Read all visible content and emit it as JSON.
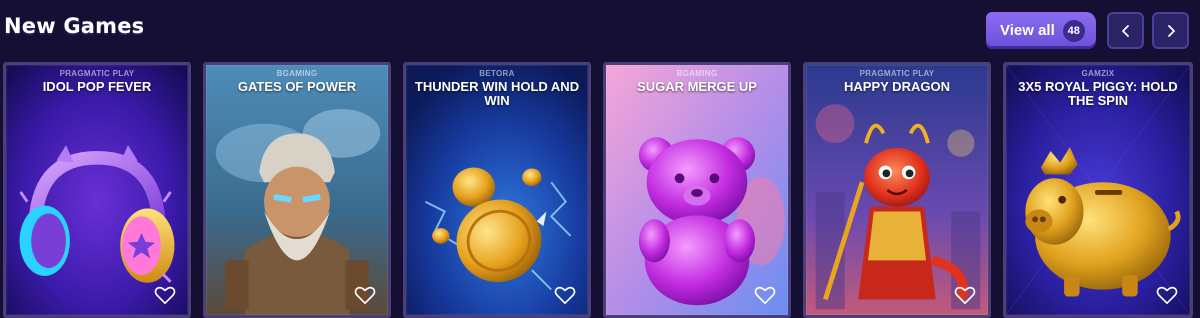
{
  "header": {
    "title": "New Games",
    "view_all_label": "View all",
    "view_all_count": "48"
  },
  "colors": {
    "background": "#140f33",
    "accent": "#7a5ee6",
    "card_border": "#4c3f78"
  },
  "games": [
    {
      "provider": "PRAGMATIC PLAY",
      "title": "IDOL POP FEVER",
      "art_icon": "headphones-icon"
    },
    {
      "provider": "BGAMING",
      "title": "GATES OF POWER",
      "art_icon": "bearded-god-icon"
    },
    {
      "provider": "BETORA",
      "title": "THUNDER WIN HOLD AND WIN",
      "art_icon": "gold-coin-icon"
    },
    {
      "provider": "BGAMING",
      "title": "SUGAR MERGE UP",
      "art_icon": "gummy-bear-icon"
    },
    {
      "provider": "PRAGMATIC PLAY",
      "title": "HAPPY DRAGON",
      "art_icon": "dragon-icon"
    },
    {
      "provider": "GAMZIX",
      "title": "3X5 ROYAL PIGGY: HOLD THE SPIN",
      "art_icon": "golden-piggy-icon"
    }
  ]
}
